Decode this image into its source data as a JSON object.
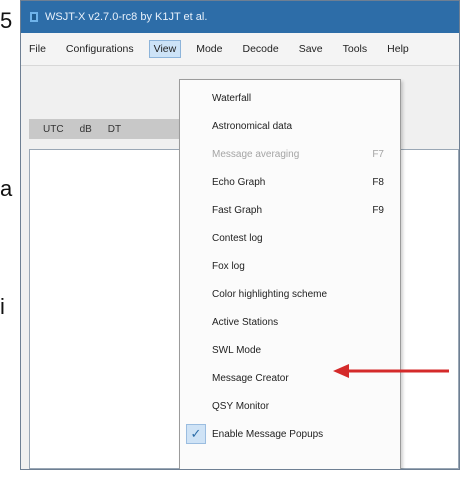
{
  "side_chars": {
    "top": "5",
    "middle": "a",
    "lower": "i"
  },
  "app": {
    "title": "WSJT-X v2.7.0-rc8 by K1JT et al."
  },
  "menubar": [
    "File",
    "Configurations",
    "View",
    "Mode",
    "Decode",
    "Save",
    "Tools",
    "Help"
  ],
  "toolbar": {
    "labels": [
      "UTC",
      "dB",
      "DT"
    ]
  },
  "view_menu": [
    {
      "label": "Waterfall",
      "shortcut": ""
    },
    {
      "label": "Astronomical data",
      "shortcut": ""
    },
    {
      "label": "Message averaging",
      "shortcut": "F7",
      "disabled": true
    },
    {
      "label": "Echo Graph",
      "shortcut": "F8"
    },
    {
      "label": "Fast Graph",
      "shortcut": "F9"
    },
    {
      "label": "Contest log",
      "shortcut": ""
    },
    {
      "label": "Fox log",
      "shortcut": ""
    },
    {
      "label": "Color highlighting scheme",
      "shortcut": ""
    },
    {
      "label": "Active Stations",
      "shortcut": ""
    },
    {
      "label": "SWL Mode",
      "shortcut": ""
    },
    {
      "label": "Message Creator",
      "shortcut": ""
    },
    {
      "label": "QSY Monitor",
      "shortcut": ""
    },
    {
      "label": "Enable Message Popups",
      "shortcut": "",
      "checked": true
    }
  ],
  "colors": {
    "titlebar": "#2d6da8",
    "arrow": "#d42a2a"
  },
  "icons": {
    "arrow": "red-arrow-icon",
    "check": "checkmark-icon"
  }
}
